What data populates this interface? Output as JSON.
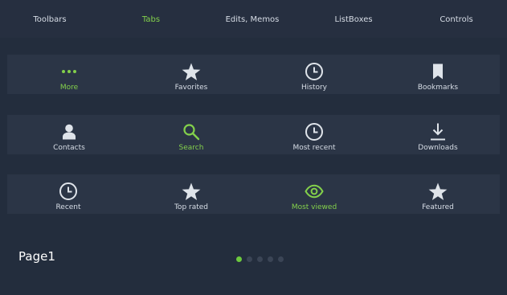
{
  "header_tabs": [
    {
      "label": "Toolbars",
      "active": false
    },
    {
      "label": "Tabs",
      "active": true
    },
    {
      "label": "Edits, Memos",
      "active": false
    },
    {
      "label": "ListBoxes",
      "active": false
    },
    {
      "label": "Controls",
      "active": false
    }
  ],
  "rows": [
    {
      "items": [
        {
          "label": "More",
          "icon": "more-icon",
          "active": true
        },
        {
          "label": "Favorites",
          "icon": "star-icon",
          "active": false
        },
        {
          "label": "History",
          "icon": "clock-icon",
          "active": false
        },
        {
          "label": "Bookmarks",
          "icon": "bookmark-icon",
          "active": false
        }
      ]
    },
    {
      "items": [
        {
          "label": "Contacts",
          "icon": "user-icon",
          "active": false
        },
        {
          "label": "Search",
          "icon": "search-icon",
          "active": true
        },
        {
          "label": "Most recent",
          "icon": "clock-icon",
          "active": false
        },
        {
          "label": "Downloads",
          "icon": "download-icon",
          "active": false
        }
      ]
    },
    {
      "items": [
        {
          "label": "Recent",
          "icon": "clock-icon",
          "active": false
        },
        {
          "label": "Top rated",
          "icon": "star-icon",
          "active": false
        },
        {
          "label": "Most viewed",
          "icon": "eye-icon",
          "active": true
        },
        {
          "label": "Featured",
          "icon": "star-icon",
          "active": false
        }
      ]
    }
  ],
  "page": {
    "label": "Page1",
    "current": 1,
    "total": 5
  },
  "colors": {
    "background": "#232d3d",
    "header_background": "#262f40",
    "row_background": "#2b3546",
    "text": "#d7dde6",
    "accent": "#83d04b",
    "dot_inactive": "#3b4556",
    "dot_active": "#6cc93e"
  }
}
